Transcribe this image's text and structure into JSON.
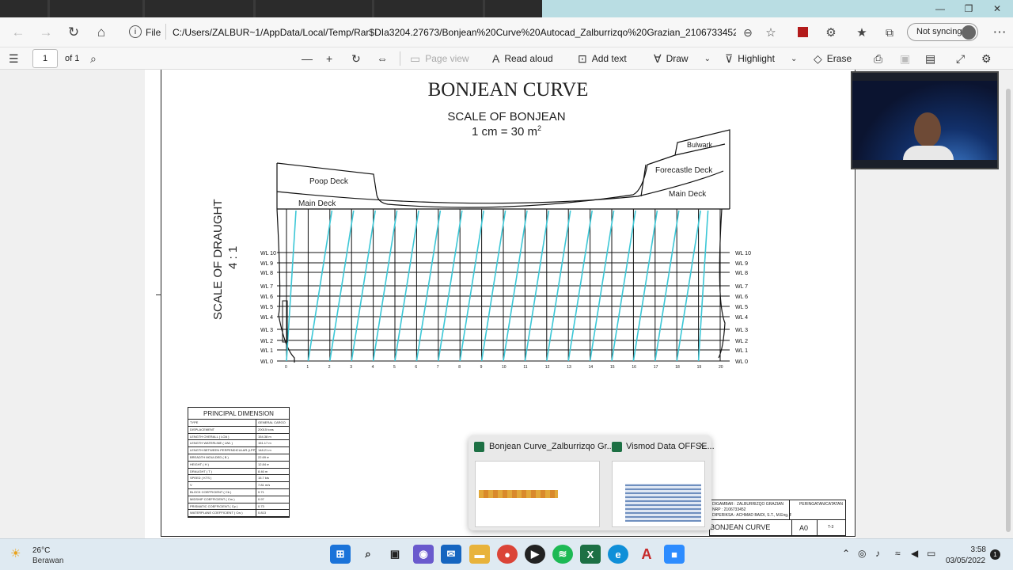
{
  "browser": {
    "file_label": "File",
    "url": "C:/Users/ZALBUR~1/AppData/Local/Temp/Rar$DIa3204.27673/Bonjean%20Curve%20Autocad_Zalburrizqo%20Grazian_2106733452-Model.pdf",
    "profile_label": "Not syncing"
  },
  "pdf_toolbar": {
    "page_number": "1",
    "page_total": "of 1",
    "page_view": "Page view",
    "read_aloud": "Read aloud",
    "add_text": "Add text",
    "draw": "Draw",
    "highlight": "Highlight",
    "erase": "Erase"
  },
  "drawing": {
    "title": "BONJEAN CURVE",
    "subtitle": "SCALE OF BONJEAN",
    "scale": "1 cm = 30 m",
    "scale_exp": "2",
    "draught_label": "SCALE OF DRAUGHT",
    "draught_ratio": "4 : 1",
    "deck_labels": {
      "poop": "Poop Deck",
      "main_aft": "Main Deck",
      "forecastle": "Forecastle Deck",
      "main_fwd": "Main Deck",
      "bulwark": "Bulwark"
    },
    "waterlines": [
      "WL 0",
      "WL 1",
      "WL 2",
      "WL 3",
      "WL 4",
      "WL 5",
      "WL 6",
      "WL 7",
      "WL 8",
      "WL 9",
      "WL 10"
    ],
    "stations": [
      "0",
      "1",
      "2",
      "3",
      "4",
      "5",
      "6",
      "7",
      "8",
      "9",
      "10",
      "11",
      "12",
      "13",
      "14",
      "15",
      "16",
      "17",
      "18",
      "19",
      "20"
    ]
  },
  "principal_dimension": {
    "title": "PRINCIPAL DIMENSION",
    "rows": [
      [
        "TYPE",
        "GENERAL CARGO"
      ],
      [
        "DISPLACEMENT",
        "20015 tons"
      ],
      [
        "LENGTH OVERALL ( LOA )",
        "154.38 m"
      ],
      [
        "LENGTH WATERLINE ( LWL )",
        "151.17 m"
      ],
      [
        "LENGTH BETWEEN PERPENDICULAR (LPP)",
        "148.21 m"
      ],
      [
        "BREADTH MOULDED ( B )",
        "22.69 m"
      ],
      [
        "HEIGHT ( H )",
        "12.84 m"
      ],
      [
        "DRAUGHT ( T )",
        "8.46 m"
      ],
      [
        "SPEED ( KTS )",
        "15.7 kts"
      ],
      [
        "V",
        "7.81 m/s"
      ],
      [
        "BLOCK COEFFICIENT ( Cb )",
        "0.71"
      ],
      [
        "MIDSHIP COEFFICIENT ( Cm )",
        "0.97"
      ],
      [
        "PRISMATIC COEFFICIENT ( Cp )",
        "0.73"
      ],
      [
        "WATERPLANE COEFFICIENT ( Cw )",
        "0.813"
      ]
    ]
  },
  "title_block": {
    "drawn": "DIGAMBAR : ZALBURRIZQO GRAZIAN",
    "nrp": "NRP : 2106733452",
    "checked": "DIPERIKSA : ACHMAD BAIDI, S.T., M.Eng, Ph.D.",
    "remarks": "PERINGATAN/CATATAN",
    "name": "BONJEAN CURVE",
    "size": "A0",
    "sheet": "T-3"
  },
  "thumbnails": [
    {
      "label": "Bonjean Curve_Zalburrizqo Gr..."
    },
    {
      "label": "Vismod Data OFFSE..."
    }
  ],
  "taskbar": {
    "temp": "26°C",
    "weather": "Berawan",
    "time": "3:58",
    "date": "03/05/2022",
    "badge": "1"
  }
}
